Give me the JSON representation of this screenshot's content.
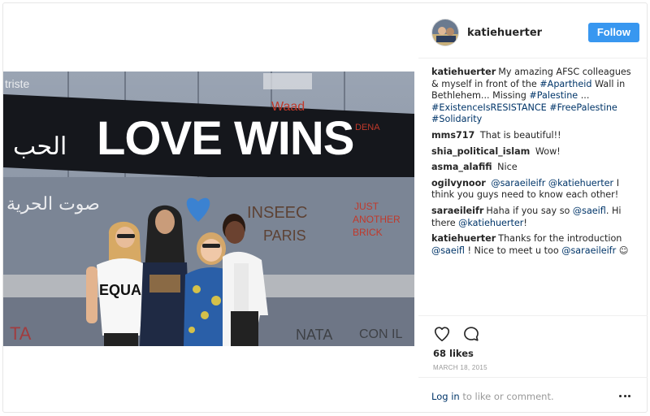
{
  "post": {
    "username": "katiehuerter",
    "follow_label": "Follow",
    "photo_text": {
      "main": "LOVE WINS",
      "shirt": "EQUA"
    },
    "caption": {
      "author": "katiehuerter",
      "text_1": "My amazing AFSC colleagues & myself in front of the ",
      "tag_1": "#Apartheid",
      "text_2": " Wall in Bethlehem... Missing ",
      "tag_2": "#Palestine",
      "text_3": " ... ",
      "tag_3": "#ExistenceIsRESISTANCE",
      "text_4": " ",
      "tag_4": "#FreePalestine",
      "text_5": " ",
      "tag_5": "#Solidarity"
    },
    "comments": [
      {
        "author": "mms717",
        "text": "That is beautiful!!"
      },
      {
        "author": "shia_political_islam",
        "text": "Wow!"
      },
      {
        "author": "asma_alafifi",
        "text": "Nice"
      },
      {
        "author": "ogilvynoor",
        "mention_1": "@saraeileifr",
        "mention_2": "@katiehuerter",
        "text": " I think you guys need to know each other!"
      },
      {
        "author": "saraeileifr",
        "text_1": "Haha if you say so ",
        "mention_1": "@saeifl",
        "text_2": ". Hi there ",
        "mention_2": "@katiehuerter",
        "text_3": "!"
      },
      {
        "author": "katiehuerter",
        "text_1": "Thanks for the introduction ",
        "mention_1": "@saeifl",
        "text_2": " ! Nice to meet u too ",
        "mention_2": "@saraeileifr",
        "text_3": " ☺"
      }
    ],
    "likes": "68 likes",
    "date": "MARCH 18, 2015",
    "login": {
      "link": "Log in",
      "rest": " to like or comment."
    }
  },
  "colors": {
    "accent": "#3897f0",
    "link": "#003569",
    "muted": "#999999"
  },
  "icons": [
    "heart-icon",
    "comment-icon",
    "more-options-icon"
  ]
}
